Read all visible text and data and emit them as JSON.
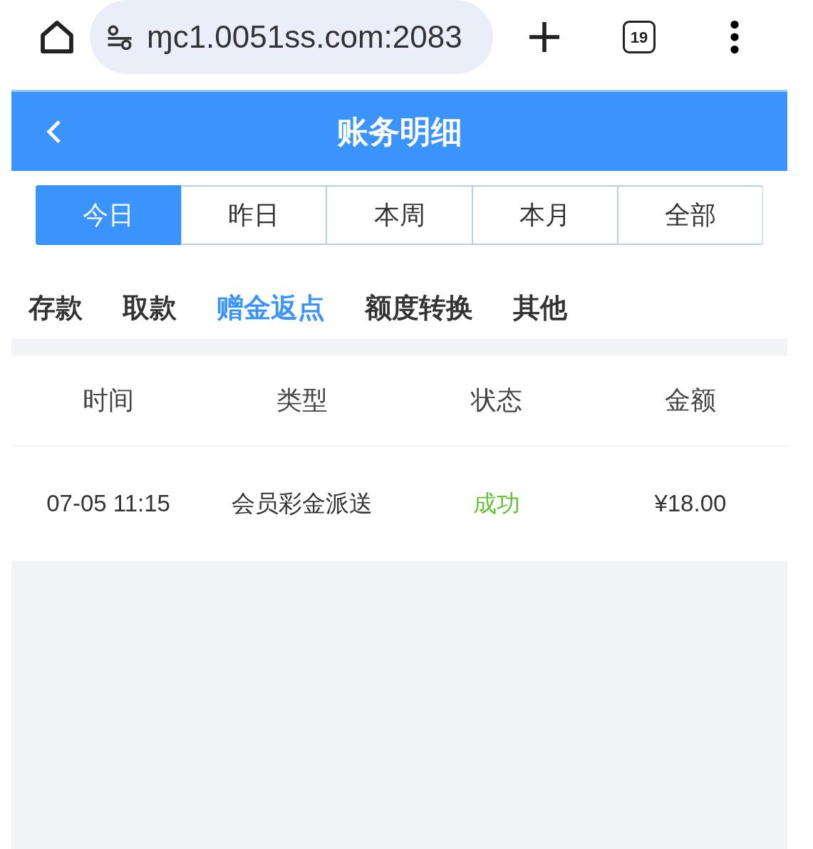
{
  "browser": {
    "url": "ɱc1.0051ss.com:2083",
    "tab_count": "19"
  },
  "header": {
    "title": "账务明细"
  },
  "periods": [
    {
      "label": "今日",
      "selected": true
    },
    {
      "label": "昨日",
      "selected": false
    },
    {
      "label": "本周",
      "selected": false
    },
    {
      "label": "本月",
      "selected": false
    },
    {
      "label": "全部",
      "selected": false
    }
  ],
  "categories": [
    {
      "label": "存款",
      "selected": false
    },
    {
      "label": "取款",
      "selected": false
    },
    {
      "label": "赠金返点",
      "selected": true
    },
    {
      "label": "额度转换",
      "selected": false
    },
    {
      "label": "其他",
      "selected": false
    }
  ],
  "table": {
    "columns": [
      "时间",
      "类型",
      "状态",
      "金额"
    ],
    "rows": [
      {
        "time": "07-05 11:15",
        "type": "会员彩金派送",
        "status": "成功",
        "color": "#67c23a",
        "amount": "¥18.00"
      }
    ]
  }
}
